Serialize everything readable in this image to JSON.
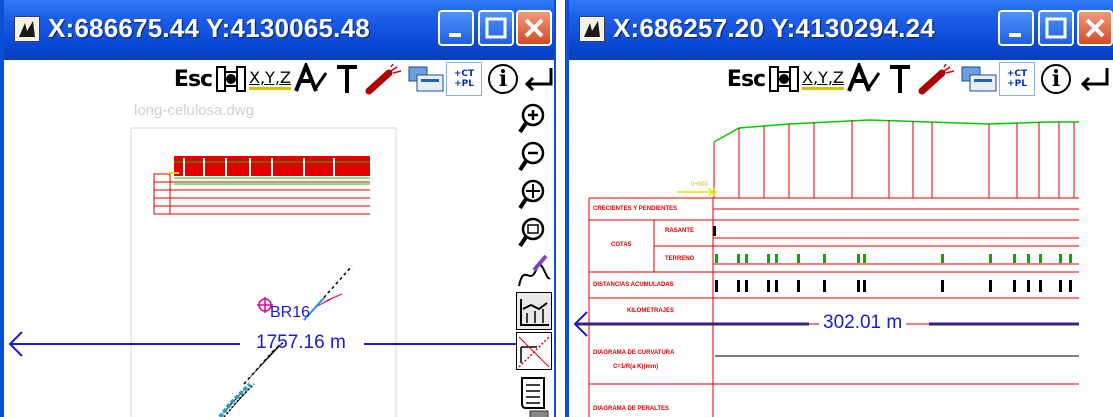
{
  "window_left": {
    "title": "X:686675.44 Y:4130065.48",
    "filename": "long-celulosa.dwg",
    "point_label": "BR16",
    "measure": "1757.16 m"
  },
  "window_right": {
    "title": "X:686257.20 Y:4130294.24",
    "measure": "302.01 m",
    "rows": {
      "crecientes": "CRECIENTES Y PENDIENTES",
      "cotas": "COTAS",
      "rasante": "RASANTE",
      "terreno": "TERRENO",
      "distancias": "DISTANCIAS ACUMULADAS",
      "kilometrajes": "KILOMETRAJES",
      "diagrama_curvatura": "DIAGRAMA DE CURVATURA",
      "curvatura_formula": "C=1/R(a K)(mm)",
      "diagrama_peraltes": "DIAGRAMA DE PERALTES"
    }
  },
  "toolbar": {
    "esc": "Esc",
    "xyz": "X,Y,Z",
    "ct": "+CT",
    "pl": "+PL",
    "info": "i"
  },
  "colors": {
    "titlebar": "#0a47d4",
    "close": "#d44a24",
    "measure": "#1a1ad0",
    "drawing_red": "#e00000",
    "drawing_green": "#00cc00",
    "drawing_yellow": "#e6e600"
  },
  "icons": [
    "app-icon",
    "minimize-icon",
    "maximize-icon",
    "close-icon",
    "escape-icon",
    "layers-icon",
    "coordinates-icon",
    "text-tool-icon",
    "pick-height-icon",
    "eraser-pen-icon",
    "export-icon",
    "info-icon",
    "enter-icon",
    "zoom-in-icon",
    "zoom-out-icon",
    "pan-icon",
    "zoom-window-icon",
    "draw-polyline-icon",
    "profile-icon",
    "measure-icon",
    "script-icon",
    "camera-icon"
  ]
}
